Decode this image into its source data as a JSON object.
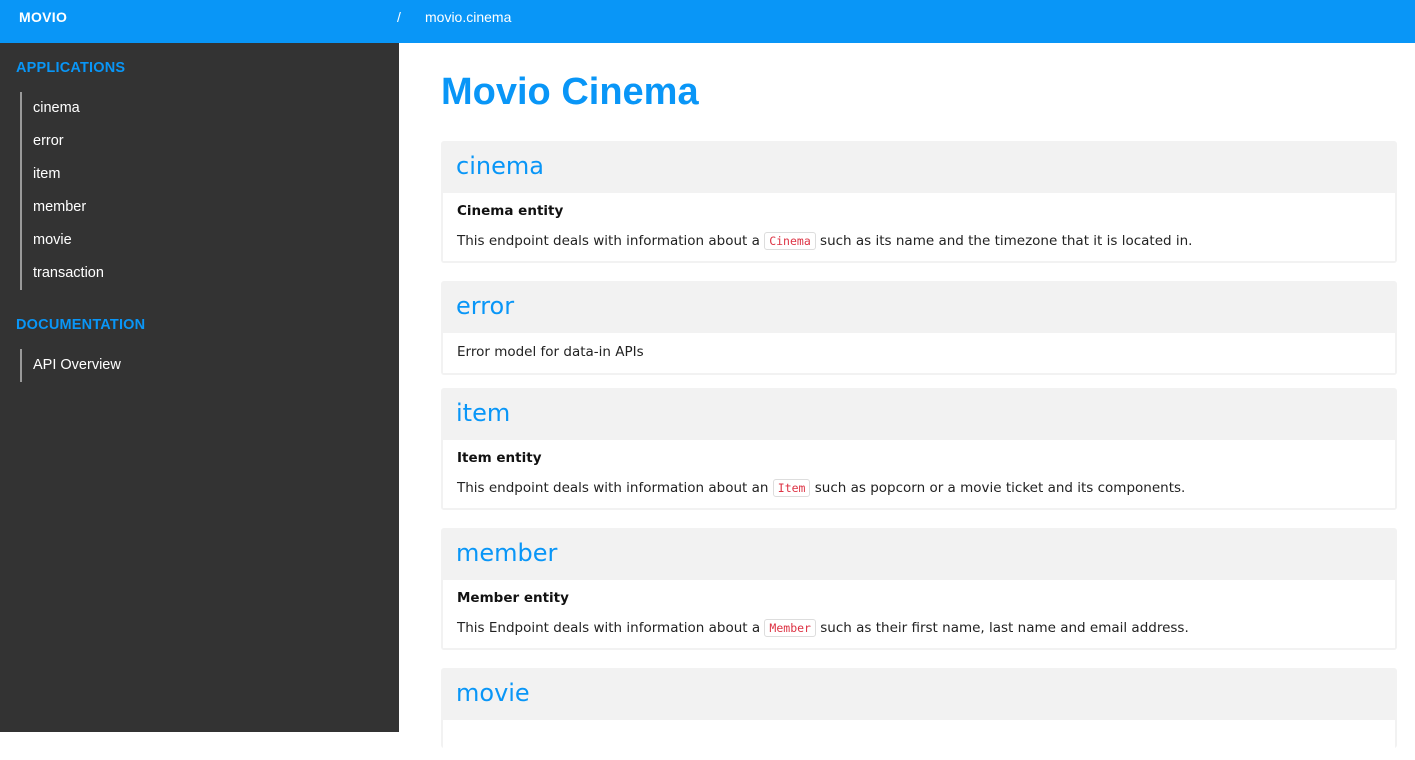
{
  "topbar": {
    "brand": "MOVIO",
    "separator": "/",
    "crumb": "movio.cinema"
  },
  "sidebar": {
    "applications_heading": "APPLICATIONS",
    "applications": [
      {
        "label": "cinema"
      },
      {
        "label": "error"
      },
      {
        "label": "item"
      },
      {
        "label": "member"
      },
      {
        "label": "movie"
      },
      {
        "label": "transaction"
      }
    ],
    "documentation_heading": "DOCUMENTATION",
    "documentation": [
      {
        "label": "API Overview"
      }
    ]
  },
  "main": {
    "title": "Movio Cinema",
    "cards": [
      {
        "title": "cinema",
        "subtitle": "Cinema entity",
        "desc_before": "This endpoint deals with information about a ",
        "code": "Cinema",
        "desc_after": " such as its name and the timezone that it is located in."
      },
      {
        "title": "error",
        "desc_before": "Error model for data-in APIs"
      },
      {
        "title": "item",
        "subtitle": "Item entity",
        "desc_before": "This endpoint deals with information about an ",
        "code": "Item",
        "desc_after": " such as popcorn or a movie ticket and its components."
      },
      {
        "title": "member",
        "subtitle": "Member entity",
        "desc_before": "This Endpoint deals with information about a ",
        "code": "Member",
        "desc_after": " such as their first name, last name and email address."
      },
      {
        "title": "movie"
      }
    ]
  },
  "colors": {
    "accent": "#0996f7",
    "sidebar_bg": "#333333",
    "card_bg": "#f2f2f2",
    "code_text": "#dd3344"
  }
}
